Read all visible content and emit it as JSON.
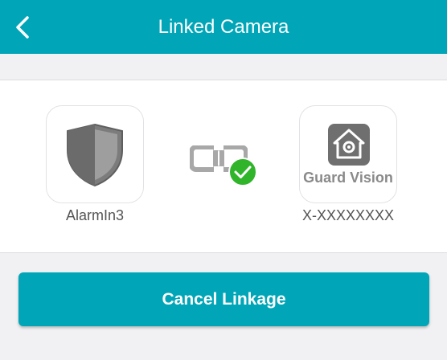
{
  "header": {
    "title": "Linked Camera",
    "back_icon": "chevron-left-icon"
  },
  "linkage": {
    "source": {
      "name": "AlarmIn3",
      "icon": "shield-icon"
    },
    "target": {
      "name": "X-XXXXXXXX",
      "icon": "guard-vision-logo-icon",
      "logo_text": "Guard Vision"
    },
    "link_icon": "chain-link-icon",
    "status_icon": "check-circle-icon"
  },
  "actions": {
    "cancel_label": "Cancel Linkage"
  },
  "colors": {
    "accent": "#00a6b8",
    "success": "#2fb42a",
    "background": "#f1f1f3"
  }
}
